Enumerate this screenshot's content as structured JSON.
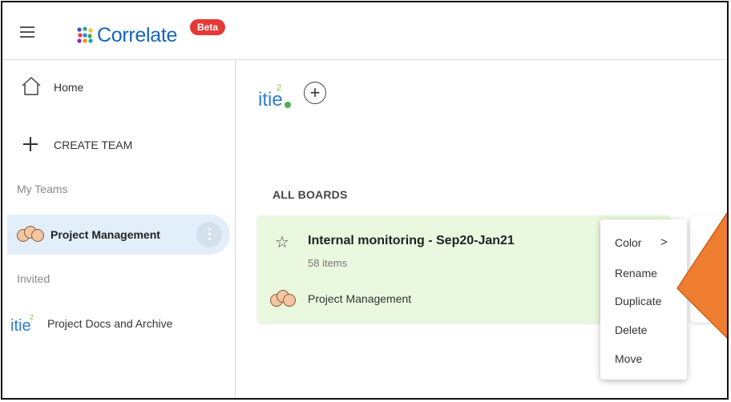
{
  "app": {
    "name": "Correlate",
    "badge": "Beta",
    "brand_color": "#1565c0",
    "badge_color": "#e53935"
  },
  "sidebar": {
    "home_label": "Home",
    "create_team_label": "CREATE TEAM",
    "my_teams_label": "My Teams",
    "invited_label": "Invited",
    "teams": [
      {
        "label": "Project Management",
        "selected": true
      }
    ],
    "invited_teams": [
      {
        "label": "Project Docs and Archive"
      }
    ]
  },
  "main": {
    "section_label": "ALL BOARDS",
    "board": {
      "title": "Internal monitoring - Sep20-Jan21",
      "item_count": "58 items",
      "team": "Project Management",
      "color": "#e9f8df"
    }
  },
  "context_menu": {
    "items": [
      "Color",
      "Rename",
      "Duplicate",
      "Delete",
      "Move"
    ],
    "chevron": ">"
  },
  "annotation": {
    "arrow_color": "#ee7d30",
    "icon": "pointer-arrow"
  }
}
